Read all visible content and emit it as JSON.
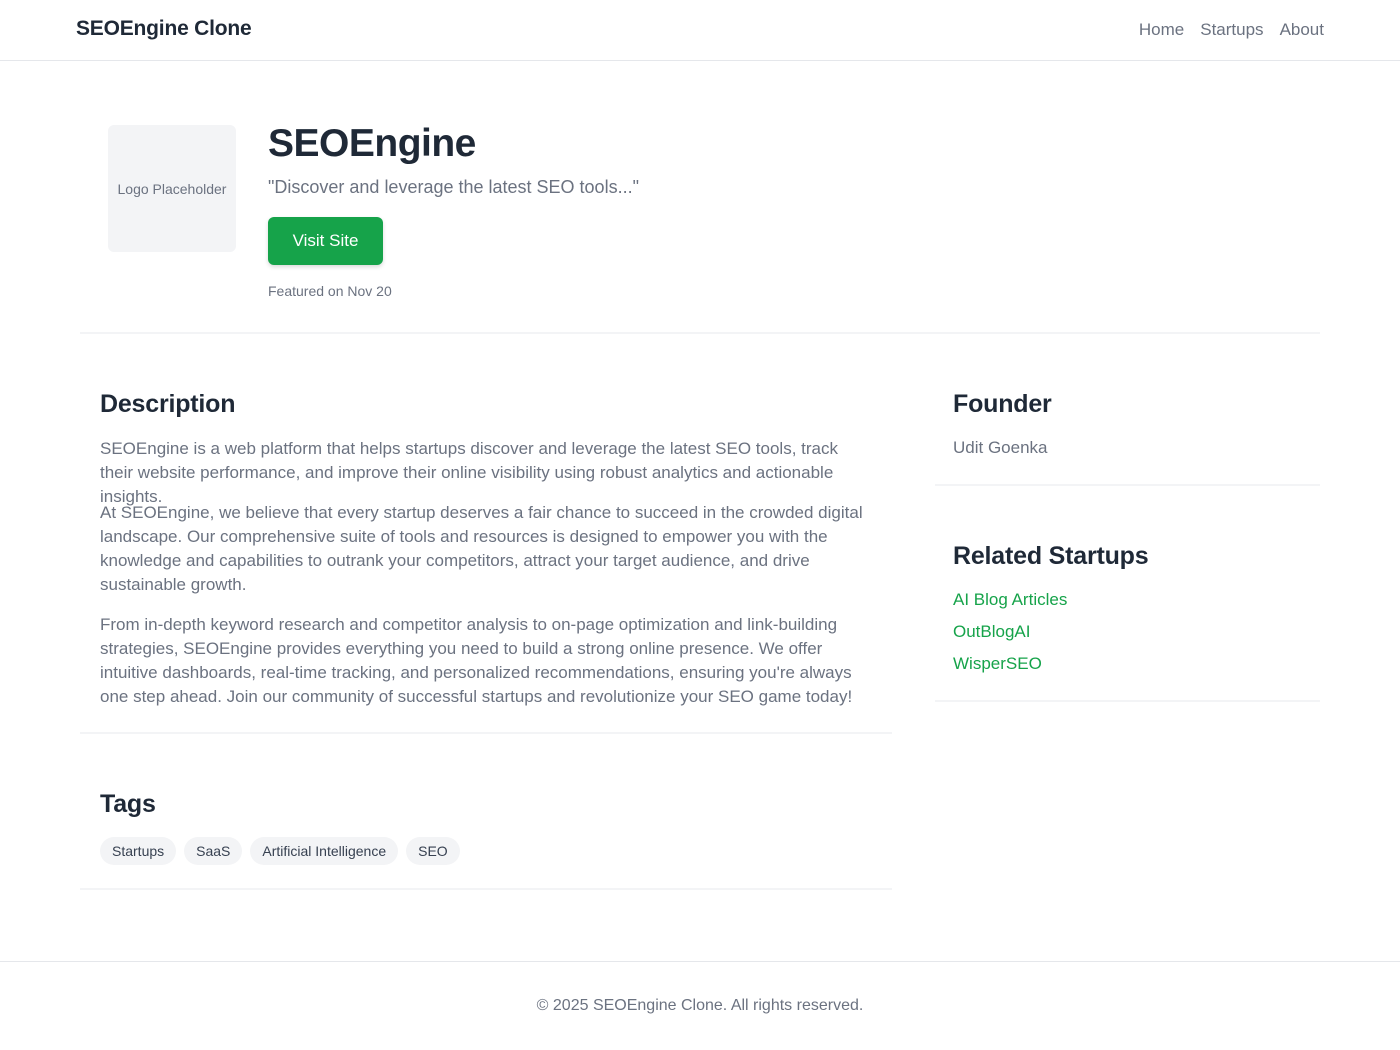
{
  "header": {
    "brand": "SEOEngine Clone",
    "nav": [
      "Home",
      "Startups",
      "About"
    ]
  },
  "hero": {
    "logo_placeholder": "Logo Placeholder",
    "title": "SEOEngine",
    "tagline": "\"Discover and leverage the latest SEO tools...\"",
    "visit_label": "Visit Site",
    "featured": "Featured on Nov 20"
  },
  "description": {
    "title": "Description",
    "paragraphs": [
      "SEOEngine is a web platform that helps startups discover and leverage the latest SEO tools, track their website performance, and improve their online visibility using robust analytics and actionable insights.",
      "At SEOEngine, we believe that every startup deserves a fair chance to succeed in the crowded digital landscape. Our comprehensive suite of tools and resources is designed to empower you with the knowledge and capabilities to outrank your competitors, attract your target audience, and drive sustainable growth.",
      "From in-depth keyword research and competitor analysis to on-page optimization and link-building strategies, SEOEngine provides everything you need to build a strong online presence. We offer intuitive dashboards, real-time tracking, and personalized recommendations, ensuring you're always one step ahead. Join our community of successful startups and revolutionize your SEO game today!"
    ]
  },
  "founder": {
    "title": "Founder",
    "name": "Udit Goenka"
  },
  "related": {
    "title": "Related Startups",
    "items": [
      "AI Blog Articles",
      "OutBlogAI",
      "WisperSEO"
    ]
  },
  "tags": {
    "title": "Tags",
    "items": [
      "Startups",
      "SaaS",
      "Artificial Intelligence",
      "SEO"
    ]
  },
  "footer": {
    "text": "© 2025 SEOEngine Clone. All rights reserved."
  },
  "colors": {
    "accent": "#16a34a",
    "text_primary": "#1f2937",
    "text_muted": "#6b7280",
    "tag_bg": "#f3f4f6"
  }
}
